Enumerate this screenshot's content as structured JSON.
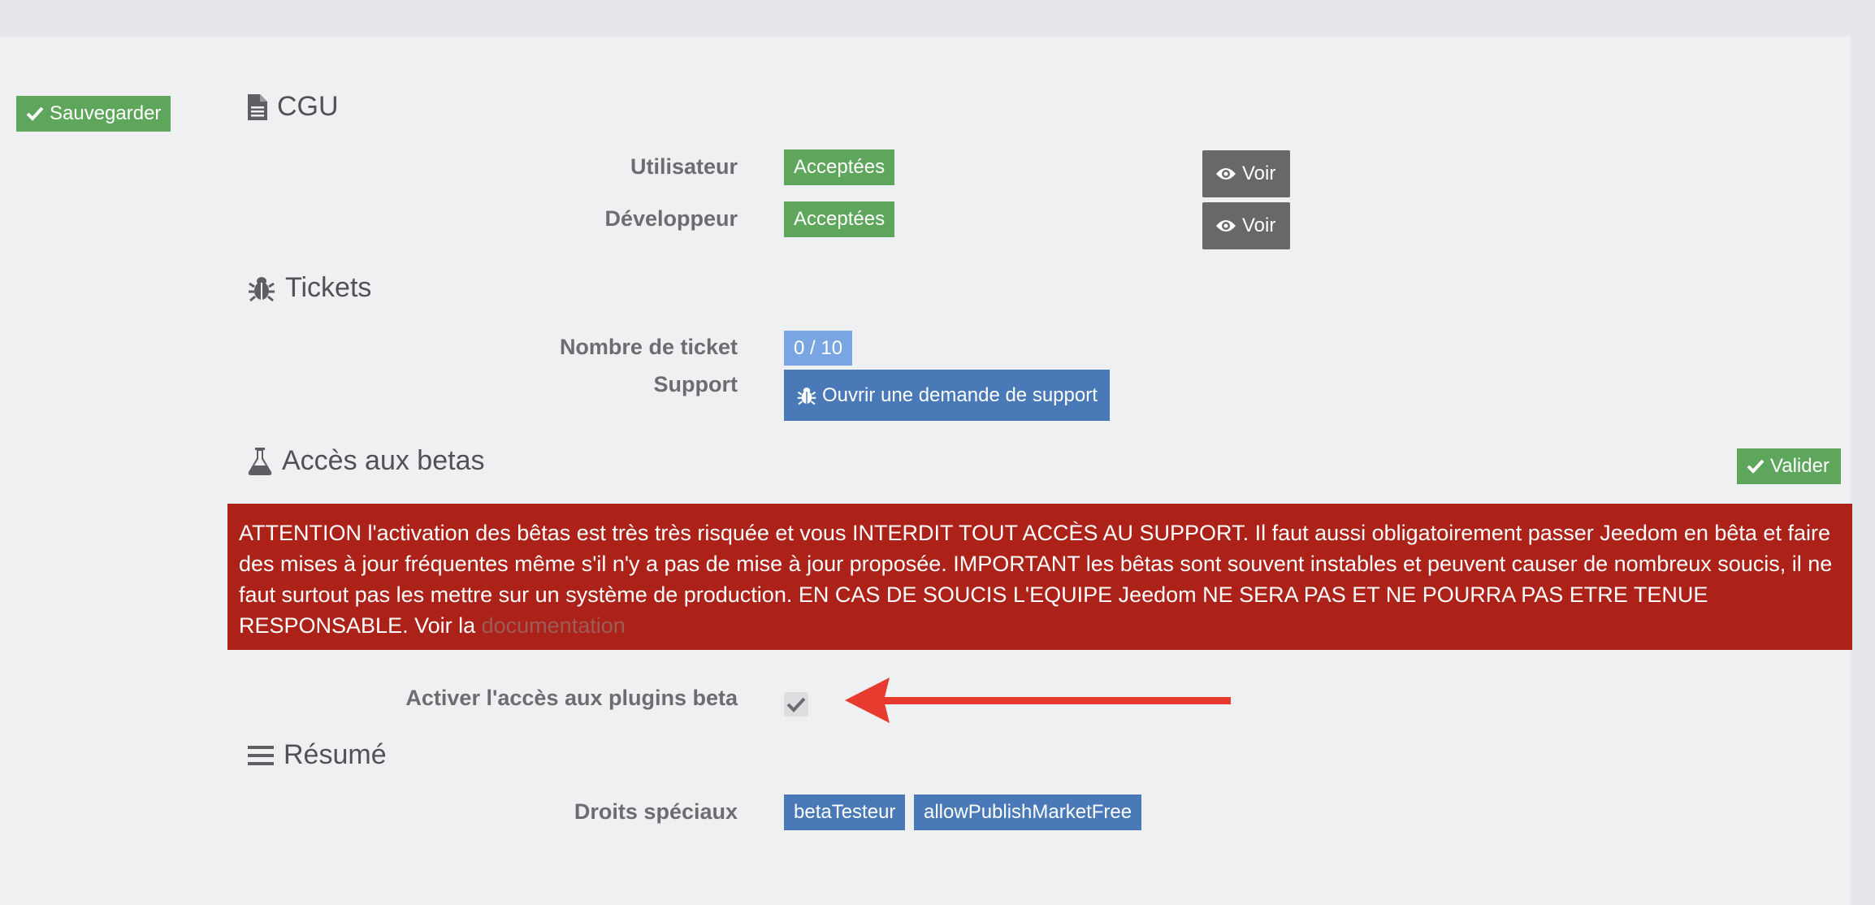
{
  "toolbar": {
    "save_label": "Sauvegarder"
  },
  "cgu": {
    "title": "CGU",
    "rows": [
      {
        "label": "Utilisateur",
        "status": "Acceptées",
        "view_label": "Voir"
      },
      {
        "label": "Développeur",
        "status": "Acceptées",
        "view_label": "Voir"
      }
    ]
  },
  "tickets": {
    "title": "Tickets",
    "count_label": "Nombre de ticket",
    "count_value": "0 / 10",
    "support_label": "Support",
    "support_button": "Ouvrir une demande de support"
  },
  "betas": {
    "title": "Accès aux betas",
    "validate_label": "Valider",
    "warning_text": "ATTENTION l'activation des bêtas est très très risquée et vous INTERDIT TOUT ACCÈS AU SUPPORT. Il faut aussi obligatoirement passer Jeedom en bêta et faire des mises à jour fréquentes même s'il n'y a pas de mise à jour proposée. IMPORTANT les bêtas sont souvent instables et peuvent causer de nombreux soucis, il ne faut surtout pas les mettre sur un système de production. EN CAS DE SOUCIS L'EQUIPE Jeedom NE SERA PAS ET NE POURRA PAS ETRE TENUE RESPONSABLE. Voir la ",
    "doc_link": "documentation",
    "plugins_label": "Activer l'accès aux plugins beta",
    "plugins_checked": true
  },
  "resume": {
    "title": "Résumé",
    "rights_label": "Droits spéciaux",
    "rights": [
      "betaTesteur",
      "allowPublishMarketFree"
    ]
  },
  "colors": {
    "success": "#5ea65b",
    "primary": "#4a79b7",
    "info": "#79a6e2",
    "danger": "#ac2118",
    "dark": "#686868",
    "annotation_arrow": "#e63b2e"
  },
  "icons": {
    "save": "check-icon",
    "cgu": "file-icon",
    "view": "eye-icon",
    "tickets": "bug-icon",
    "betas": "flask-icon",
    "resume": "bars-icon",
    "annotation": "arrow-left-icon"
  }
}
